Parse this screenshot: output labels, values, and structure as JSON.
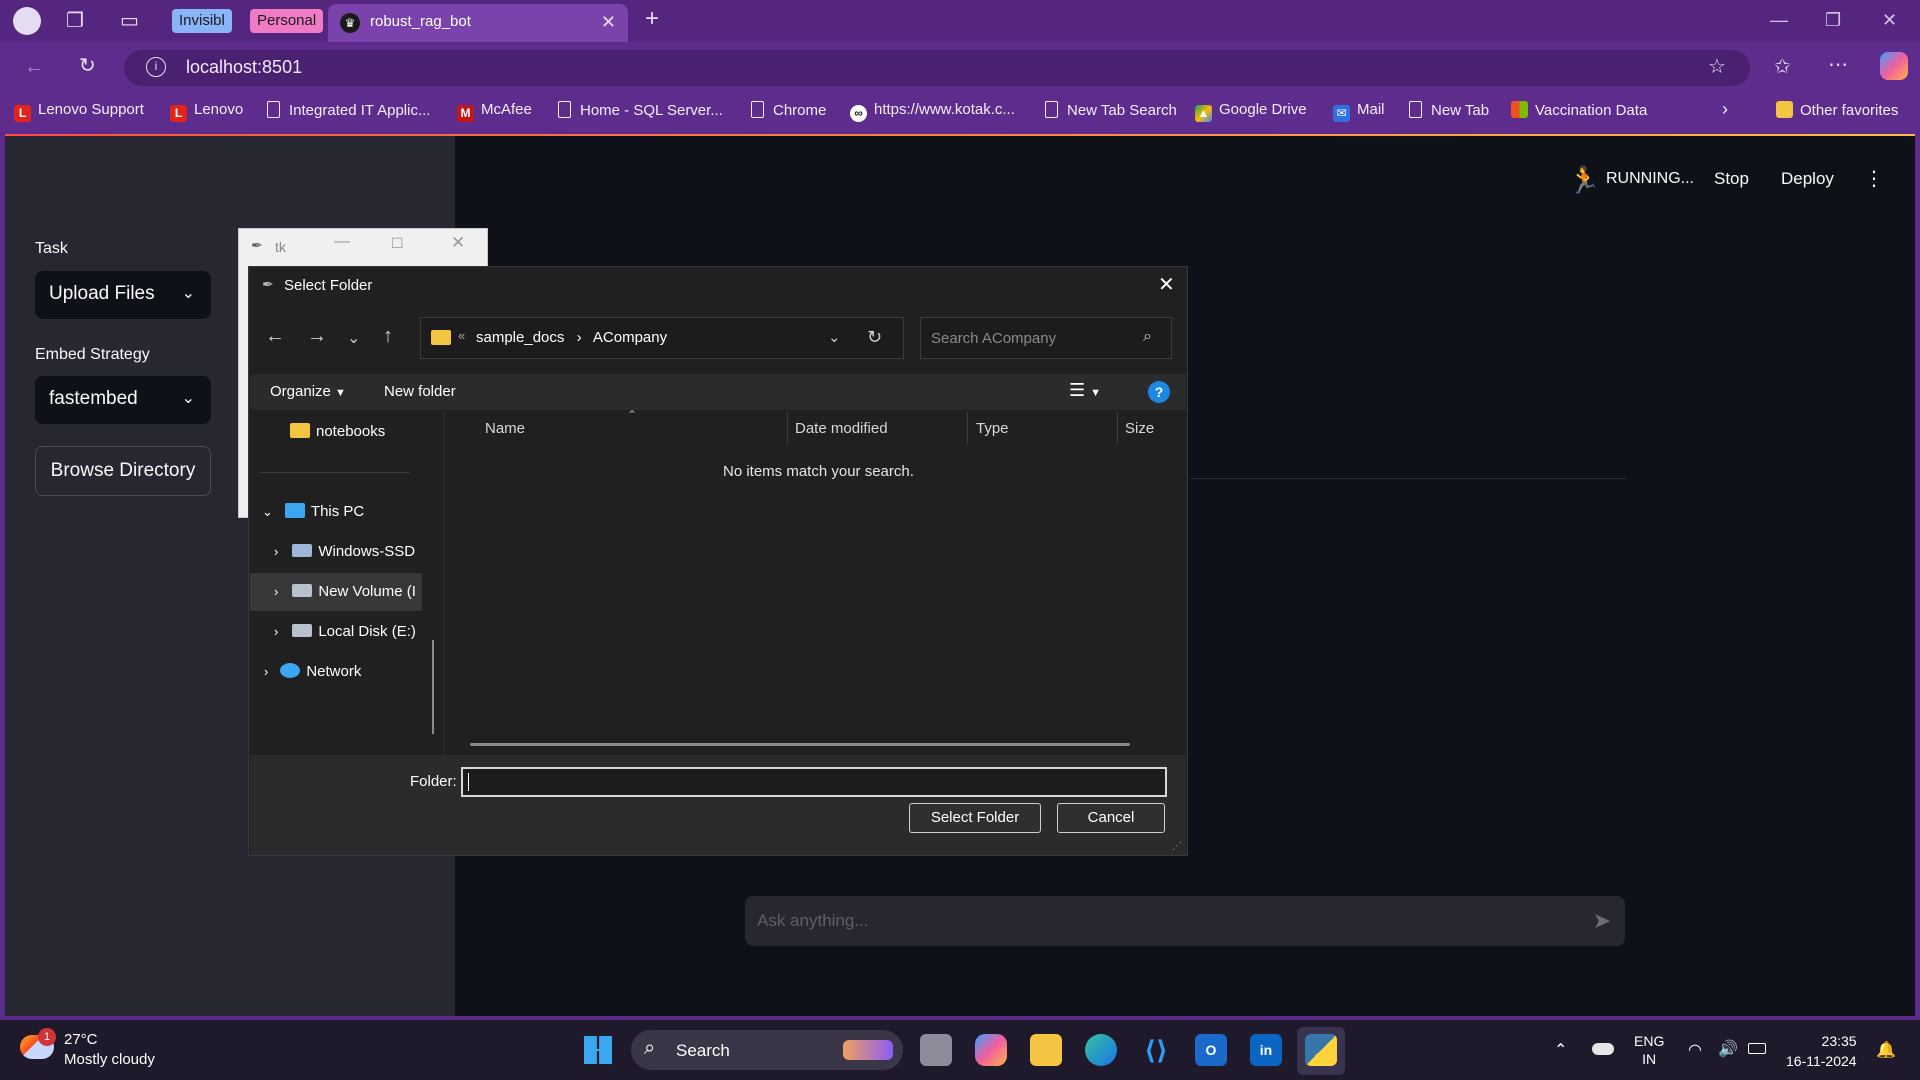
{
  "browser": {
    "tabs": {
      "badge1": "Invisibl",
      "badge2": "Personal",
      "active_title": "robust_rag_bot",
      "active_favicon": "crown-icon"
    },
    "url": "localhost:8501",
    "bookmarks": [
      "Lenovo Support",
      "Lenovo",
      "Integrated IT Applic...",
      "McAfee",
      "Home - SQL Server...",
      "Chrome",
      "https://www.kotak.c...",
      "New Tab Search",
      "Google Drive",
      "Mail",
      "New Tab",
      "Vaccination Data"
    ],
    "other_favorites": "Other favorites"
  },
  "app": {
    "sidebar": {
      "task_label": "Task",
      "task_value": "Upload Files",
      "embed_label": "Embed Strategy",
      "embed_value": "fastembed",
      "browse_button": "Browse Directory"
    },
    "header": {
      "status": "RUNNING...",
      "stop": "Stop",
      "deploy": "Deploy"
    },
    "chat_placeholder": "Ask anything..."
  },
  "tk_window": {
    "title": "tk"
  },
  "dialog": {
    "title": "Select Folder",
    "breadcrumb": {
      "parent": "sample_docs",
      "current": "ACompany"
    },
    "search_placeholder": "Search ACompany",
    "commands": {
      "organize": "Organize",
      "new_folder": "New folder"
    },
    "nav": {
      "quick": "notebooks",
      "this_pc": "This PC",
      "drives": [
        "Windows-SSD",
        "New Volume (I",
        "Local Disk (E:)"
      ],
      "network": "Network"
    },
    "columns": [
      "Name",
      "Date modified",
      "Type",
      "Size"
    ],
    "empty_message": "No items match your search.",
    "folder_label": "Folder:",
    "folder_value": "",
    "select_button": "Select Folder",
    "cancel_button": "Cancel"
  },
  "taskbar": {
    "weather": {
      "temp": "27°C",
      "desc": "Mostly cloudy",
      "badge": "1"
    },
    "search": "Search",
    "lang": "ENG",
    "region": "IN",
    "time": "23:35",
    "date": "16-11-2024"
  }
}
